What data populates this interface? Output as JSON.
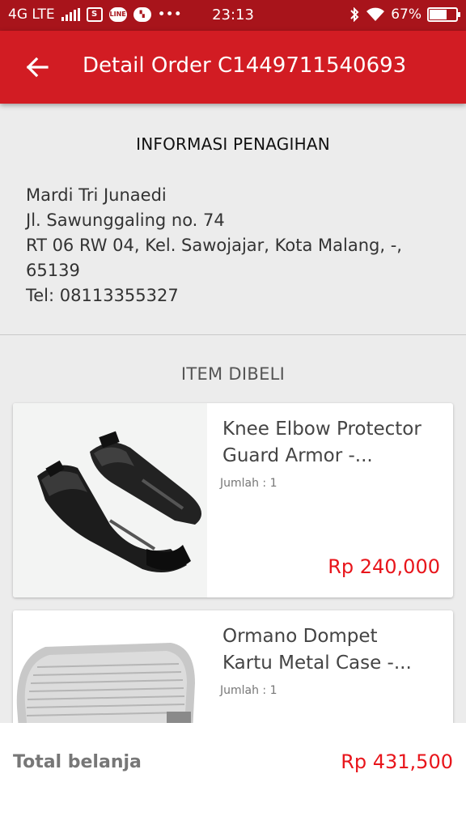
{
  "status_bar": {
    "network": "4G LTE",
    "time": "23:13",
    "battery": "67%",
    "battery_level": 0.67,
    "icons": [
      "signal-icon",
      "sim-icon",
      "line-icon",
      "bbm-icon",
      "more-icon",
      "bluetooth-icon",
      "wifi-icon",
      "battery-icon"
    ],
    "line_label": "LINE",
    "sim_label": "S",
    "more_label": "•••"
  },
  "app_bar": {
    "title": "Detail Order C1449711540693",
    "back_icon": "arrow-left-icon"
  },
  "billing": {
    "heading": "INFORMASI PENAGIHAN",
    "name": "Mardi Tri Junaedi",
    "street": "Jl. Sawunggaling no. 74",
    "area": "RT 06 RW 04, Kel. Sawojajar, Kota Malang, -,",
    "postal": "65139",
    "phone": "Tel: 08113355327"
  },
  "items": {
    "heading": "ITEM DIBELI",
    "list": [
      {
        "name_line1": "Knee Elbow Protector",
        "name_line2": "Guard Armor -...",
        "qty": "Jumlah : 1",
        "price": "Rp 240,000"
      },
      {
        "name_line1": "Ormano Dompet",
        "name_line2": "Kartu Metal Case -...",
        "qty": "Jumlah : 1",
        "price": ""
      }
    ]
  },
  "footer": {
    "label": "Total belanja",
    "total": "Rp 431,500"
  },
  "colors": {
    "status_bar": "#a8141b",
    "app_bar": "#d21c23",
    "price": "#e8151b",
    "background": "#ececec"
  }
}
